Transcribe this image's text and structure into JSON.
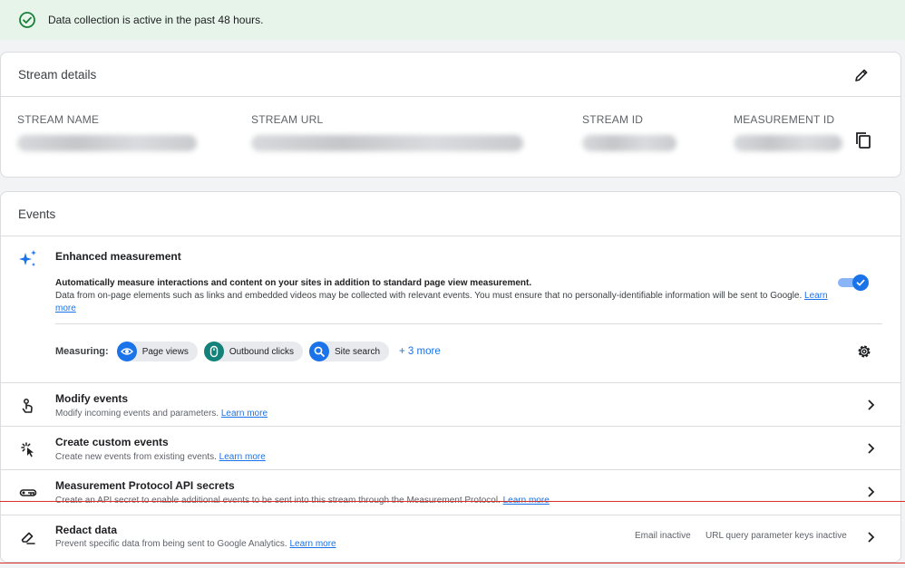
{
  "banner": {
    "text": "Data collection is active in the past 48 hours."
  },
  "stream_details": {
    "title": "Stream details",
    "columns": {
      "name": "STREAM NAME",
      "url": "STREAM URL",
      "id": "STREAM ID",
      "measurement_id": "MEASUREMENT ID"
    }
  },
  "events": {
    "title": "Events",
    "enhanced": {
      "title": "Enhanced measurement",
      "desc_bold": "Automatically measure interactions and content on your sites in addition to standard page view measurement.",
      "desc": "Data from on-page elements such as links and embedded videos may be collected with relevant events. You must ensure that no personally-identifiable information will be sent to Google.",
      "learn_more": "Learn more",
      "enabled": true
    },
    "measuring": {
      "label": "Measuring:",
      "chips": [
        "Page views",
        "Outbound clicks",
        "Site search"
      ],
      "more": "+ 3 more"
    },
    "rows": [
      {
        "title": "Modify events",
        "desc": "Modify incoming events and parameters.",
        "learn_more": "Learn more",
        "icon": "touch-icon"
      },
      {
        "title": "Create custom events",
        "desc": "Create new events from existing events.",
        "learn_more": "Learn more",
        "icon": "sparkle-click-icon"
      },
      {
        "title": "Measurement Protocol API secrets",
        "desc": "Create an API secret to enable additional events to be sent into this stream through the Measurement Protocol.",
        "learn_more": "Learn more",
        "icon": "key-icon"
      }
    ]
  },
  "redact": {
    "title": "Redact data",
    "desc": "Prevent specific data from being sent to Google Analytics.",
    "learn_more": "Learn more",
    "status_email": "Email inactive",
    "status_url": "URL query parameter keys inactive"
  },
  "colors": {
    "accent": "#1a73e8",
    "success_bg": "#e6f4ea",
    "success": "#188038",
    "highlight": "#d93025"
  }
}
